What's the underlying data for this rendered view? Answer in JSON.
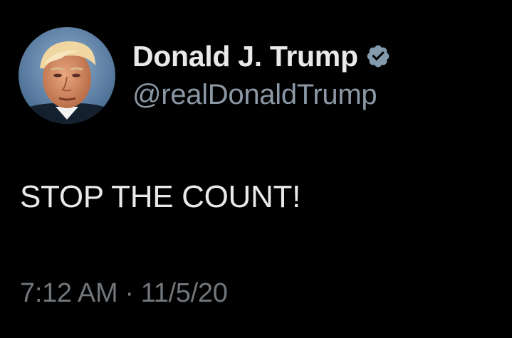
{
  "author": {
    "display_name": "Donald J. Trump",
    "handle": "@realDonaldTrump",
    "verified_icon": "verified-badge-icon",
    "avatar": "profile-photo"
  },
  "tweet": {
    "text": "STOP THE COUNT!",
    "time": "7:12 AM",
    "separator": "·",
    "date": "11/5/20"
  },
  "colors": {
    "background": "#000000",
    "primary_text": "#e7e9ea",
    "secondary_text": "#8b98a5",
    "meta_text": "#71767b",
    "verified_badge": "#829aab"
  }
}
